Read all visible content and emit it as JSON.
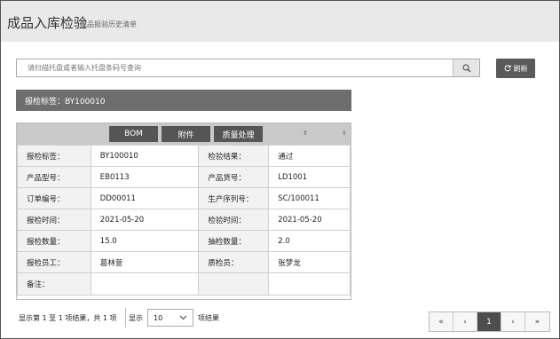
{
  "header": {
    "title": "成品入库检验",
    "subtitle": "成品报验历史清单"
  },
  "search": {
    "placeholder": "请扫描托盘或者输入托盘条码号查询",
    "value": ""
  },
  "refresh_label": "刷新",
  "label_bar": "报检标签：BY100010",
  "toolbar": {
    "bom": "BOM",
    "attachment": "附件",
    "quality": "质量处理"
  },
  "details": [
    {
      "k1": "报检标签：",
      "v1": "BY100010",
      "k2": "检验结果：",
      "v2": "通过"
    },
    {
      "k1": "产品型号：",
      "v1": "EB0113",
      "k2": "产品货号：",
      "v2": "LD1001"
    },
    {
      "k1": "订单编号：",
      "v1": "DD00011",
      "k2": "生产序列号：",
      "v2": "SC/100011"
    },
    {
      "k1": "报检时间：",
      "v1": "2021-05-20",
      "k2": "检验时间：",
      "v2": "2021-05-20"
    },
    {
      "k1": "报检数量：",
      "v1": "15.0",
      "k2": "抽检数量：",
      "v2": "2.0"
    },
    {
      "k1": "报检员工：",
      "v1": "葛林萱",
      "k2": "质检员：",
      "v2": "张梦龙"
    },
    {
      "k1": "备注：",
      "v1": "",
      "k2": "",
      "v2": ""
    }
  ],
  "footer": {
    "summary": "显示第 1 至 1 项结果，共 1 项",
    "show": "显示",
    "page_size": "10",
    "items_suffix": "项结果"
  },
  "pagination": {
    "first": "«",
    "prev": "‹",
    "current": "1",
    "next": "›",
    "last": "»"
  }
}
